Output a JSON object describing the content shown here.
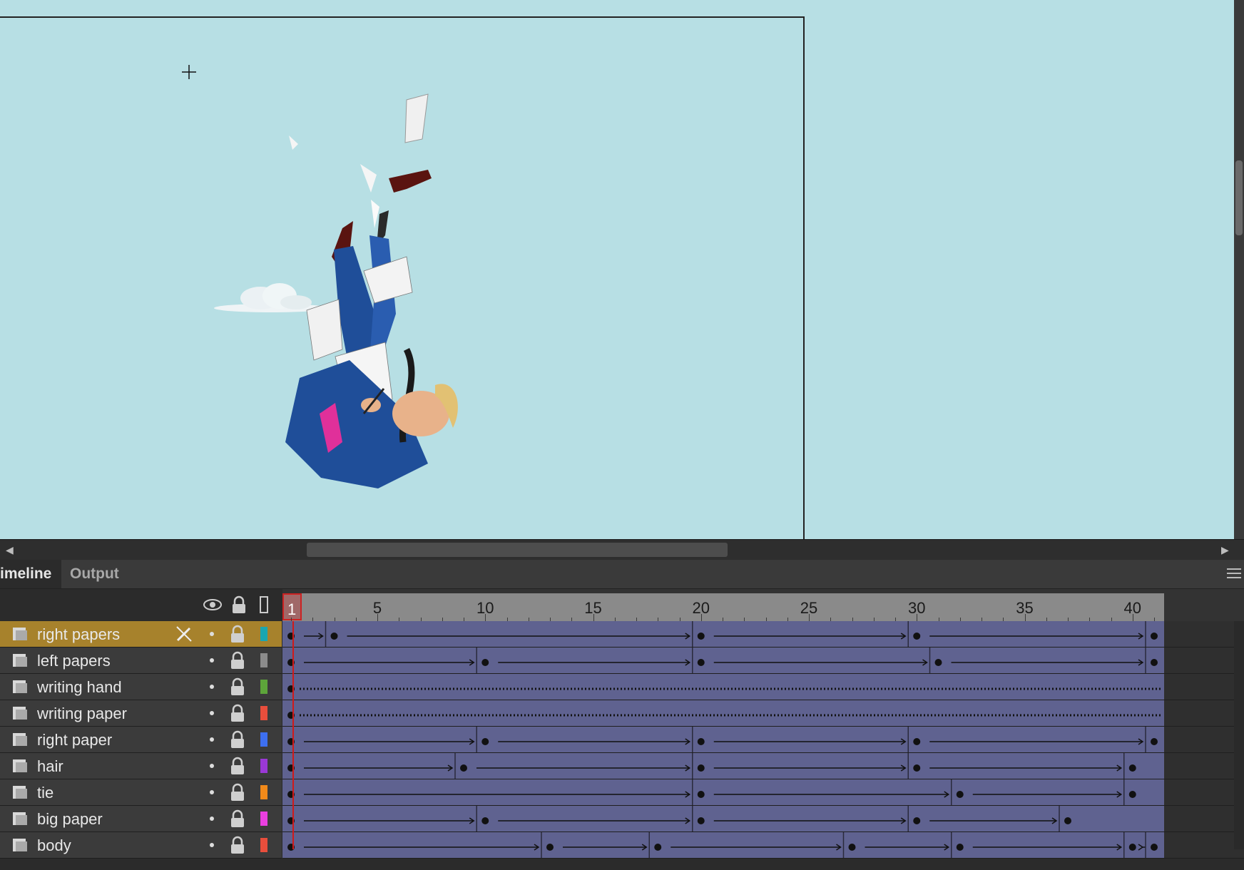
{
  "tabs": [
    {
      "label": "imeline",
      "active": true
    },
    {
      "label": "Output",
      "active": false
    }
  ],
  "ruler": {
    "current_frame": "1",
    "labels": [
      "5",
      "10",
      "15",
      "20",
      "25",
      "30",
      "35",
      "40"
    ]
  },
  "layers": [
    {
      "name": "right papers",
      "color": "#1aa6b0",
      "active": true,
      "keyframes": [
        1,
        3,
        20,
        30,
        41
      ],
      "kind": "tween"
    },
    {
      "name": "left papers",
      "color": "#8c8c8c",
      "active": false,
      "keyframes": [
        1,
        10,
        20,
        31,
        41
      ],
      "kind": "tween"
    },
    {
      "name": "writing hand",
      "color": "#5da53a",
      "active": false,
      "keyframes": [
        1
      ],
      "kind": "static"
    },
    {
      "name": "writing paper",
      "color": "#e84e3c",
      "active": false,
      "keyframes": [
        1
      ],
      "kind": "static"
    },
    {
      "name": "right paper",
      "color": "#3d6ff0",
      "active": false,
      "keyframes": [
        1,
        10,
        20,
        30,
        41
      ],
      "kind": "tween"
    },
    {
      "name": "hair",
      "color": "#9a38d6",
      "active": false,
      "keyframes": [
        1,
        9,
        20,
        30,
        40
      ],
      "kind": "tween"
    },
    {
      "name": "tie",
      "color": "#f28a1a",
      "active": false,
      "keyframes": [
        1,
        20,
        32,
        40
      ],
      "kind": "tween"
    },
    {
      "name": "big paper",
      "color": "#ea3fe0",
      "active": false,
      "keyframes": [
        1,
        10,
        20,
        30,
        37
      ],
      "kind": "tween"
    },
    {
      "name": "body",
      "color": "#e84e3c",
      "active": false,
      "keyframes": [
        1,
        13,
        18,
        27,
        32,
        40,
        41
      ],
      "kind": "tween"
    }
  ],
  "icons": {
    "eye": "eye-icon",
    "lock": "lock-icon",
    "outline": "outline-icon",
    "layer": "layer-icon",
    "pencil": "pencil-disabled-icon",
    "crosshair": "crosshair-cursor-icon",
    "menu": "panel-menu-icon"
  },
  "colors": {
    "stage_bg": "#b7dfe4",
    "active_layer": "#a7822c",
    "tween_span": "#5f6290",
    "playhead": "#d01a1a"
  }
}
